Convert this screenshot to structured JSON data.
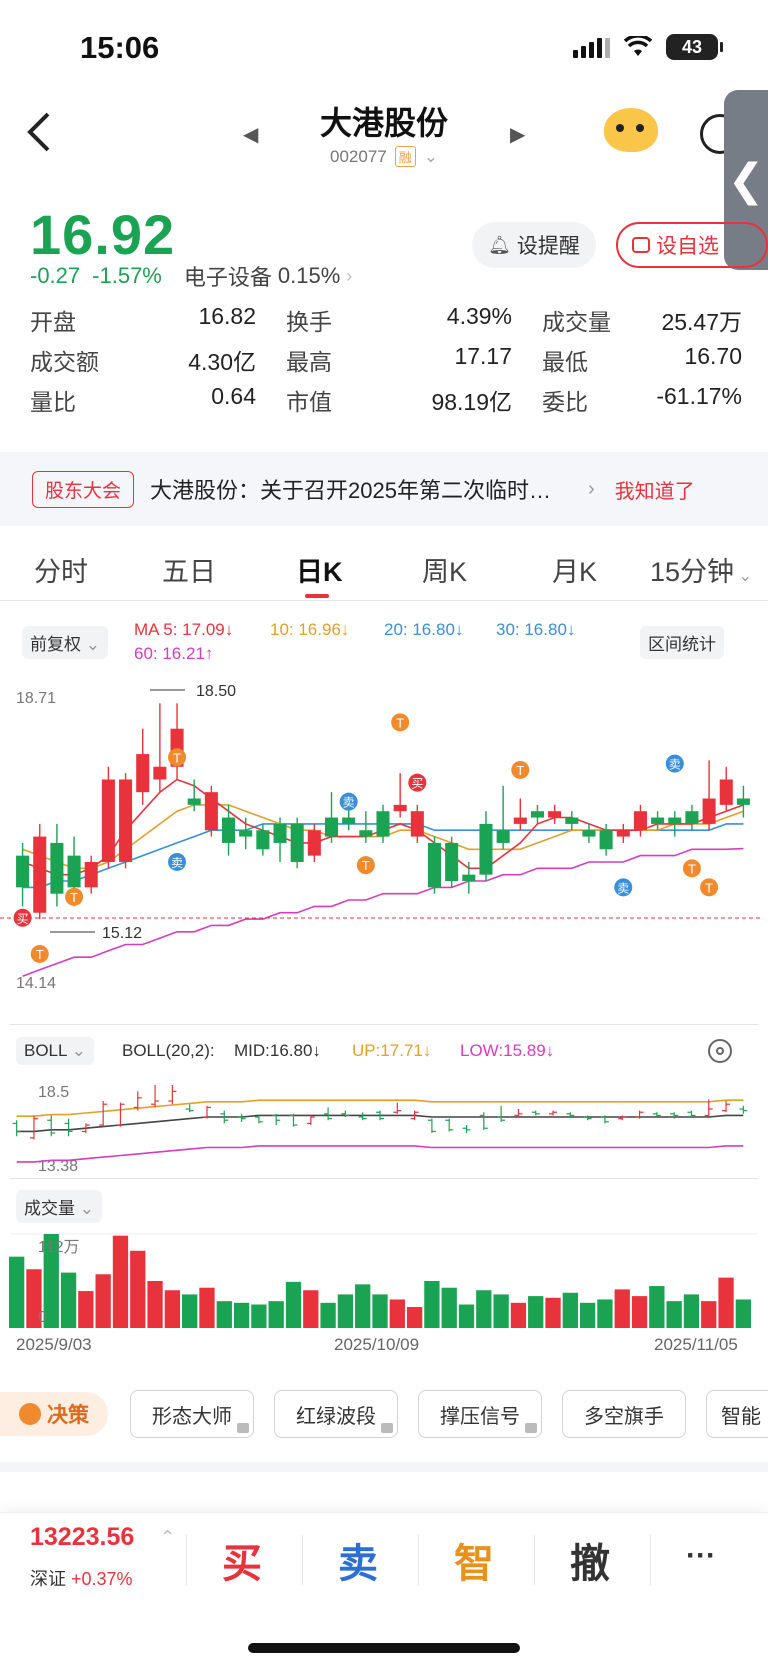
{
  "status_bar": {
    "time": "15:06",
    "battery": "43"
  },
  "header": {
    "stock_name": "大港股份",
    "stock_code": "002077",
    "margin_badge": "融",
    "side_tab_icon": "chevron-left-icon"
  },
  "quote": {
    "price": "16.92",
    "change": "-0.27",
    "change_pct": "-1.57%",
    "sector": "电子设备",
    "sector_pct": "0.15%",
    "alert_label": "设提醒",
    "watch_label": "设自选",
    "stats": [
      [
        {
          "label": "开盘",
          "value": "16.82",
          "color": "green"
        },
        {
          "label": "换手",
          "value": "4.39%",
          "color": "dark"
        },
        {
          "label": "成交量",
          "value": "25.47万",
          "color": "dark"
        }
      ],
      [
        {
          "label": "成交额",
          "value": "4.30亿",
          "color": "dark"
        },
        {
          "label": "最高",
          "value": "17.17",
          "color": "green"
        },
        {
          "label": "最低",
          "value": "16.70",
          "color": "green"
        }
      ],
      [
        {
          "label": "量比",
          "value": "0.64",
          "color": "dark"
        },
        {
          "label": "市值",
          "value": "98.19亿",
          "color": "dark"
        },
        {
          "label": "委比",
          "value": "-61.17%",
          "color": "green"
        }
      ]
    ]
  },
  "notice": {
    "tag": "股东大会",
    "text": "大港股份：关于召开2025年第二次临时…",
    "ack": "我知道了"
  },
  "tabs": [
    "分时",
    "五日",
    "日K",
    "周K",
    "月K",
    "15分钟"
  ],
  "active_tab": "日K",
  "ma": {
    "adjust": "前复权",
    "ma5": "MA 5: 17.09↓",
    "ma10": "10: 16.96↓",
    "ma20": "20: 16.80↓",
    "ma30": "30: 16.80↓",
    "ma60": "60: 16.21↑",
    "range_stats": "区间统计"
  },
  "kline": {
    "y_top_label": "18.71",
    "y_bottom_label": "14.14",
    "max_label": "18.50",
    "min_label": "15.12",
    "signal_buy": "买",
    "signal_sell": "卖",
    "signal_t": "T"
  },
  "boll": {
    "name": "BOLL",
    "params": "BOLL(20,2):",
    "mid": "MID:16.80↓",
    "up": "UP:17.71↓",
    "low": "LOW:15.89↓",
    "y_top": "18.5",
    "y_bottom": "13.38"
  },
  "volume": {
    "name": "成交量",
    "y_top": "112万",
    "y_bottom": "0"
  },
  "dates": [
    "2025/9/03",
    "2025/10/09",
    "2025/11/05"
  ],
  "tools": {
    "decision": "决策",
    "items": [
      "形态大师",
      "红绿波段",
      "撑压信号",
      "多空旗手",
      "智能"
    ]
  },
  "bottom": {
    "index_value": "13223.56",
    "index_name": "深证",
    "index_change": "+0.37%",
    "buy": "买",
    "sell": "卖",
    "smart": "智",
    "cancel": "撤",
    "more": "···"
  },
  "colors": {
    "up": "#e8323c",
    "down": "#1aa352",
    "ma5": "#e8323c",
    "ma10": "#e0a12a",
    "ma20": "#3a8fd9",
    "ma30": "#5bb8c9",
    "ma60": "#d63cc0"
  },
  "chart_data": [
    {
      "type": "candlestick",
      "title": "日K",
      "x_start": "2025/9/03",
      "x_end": "2025/11/05",
      "ylim": [
        14.14,
        18.71
      ],
      "candles": [
        [
          16.1,
          15.6,
          16.3,
          15.3
        ],
        [
          15.2,
          16.4,
          16.6,
          15.1
        ],
        [
          16.3,
          15.5,
          16.6,
          15.3
        ],
        [
          16.1,
          15.6,
          16.4,
          15.3
        ],
        [
          15.6,
          16.0,
          16.1,
          15.5
        ],
        [
          16.0,
          17.3,
          17.5,
          15.9
        ],
        [
          16.0,
          17.3,
          17.4,
          15.9
        ],
        [
          17.1,
          17.7,
          18.1,
          16.9
        ],
        [
          17.3,
          17.5,
          18.5,
          17.1
        ],
        [
          17.5,
          18.1,
          18.5,
          17.3
        ],
        [
          17.0,
          16.9,
          17.3,
          16.8
        ],
        [
          16.5,
          17.1,
          17.2,
          16.4
        ],
        [
          16.7,
          16.3,
          16.9,
          16.1
        ],
        [
          16.5,
          16.4,
          16.7,
          16.2
        ],
        [
          16.5,
          16.2,
          16.6,
          16.1
        ],
        [
          16.6,
          16.3,
          16.7,
          16.0
        ],
        [
          16.6,
          16.0,
          16.7,
          15.9
        ],
        [
          16.1,
          16.5,
          16.6,
          16.0
        ],
        [
          16.7,
          16.4,
          17.1,
          16.3
        ],
        [
          16.7,
          16.6,
          16.9,
          16.5
        ],
        [
          16.5,
          16.4,
          16.8,
          16.3
        ],
        [
          16.8,
          16.4,
          16.9,
          16.3
        ],
        [
          16.8,
          16.9,
          17.4,
          16.7
        ],
        [
          16.4,
          16.8,
          16.9,
          16.3
        ],
        [
          16.3,
          15.6,
          16.4,
          15.5
        ],
        [
          16.3,
          15.7,
          16.4,
          15.6
        ],
        [
          15.8,
          15.7,
          16.0,
          15.5
        ],
        [
          16.6,
          15.8,
          16.8,
          15.7
        ],
        [
          16.5,
          16.3,
          17.2,
          16.2
        ],
        [
          16.6,
          16.7,
          17.0,
          16.5
        ],
        [
          16.8,
          16.7,
          16.9,
          16.6
        ],
        [
          16.7,
          16.8,
          16.9,
          16.6
        ],
        [
          16.7,
          16.6,
          16.8,
          16.5
        ],
        [
          16.5,
          16.4,
          16.6,
          16.3
        ],
        [
          16.5,
          16.2,
          16.6,
          16.1
        ],
        [
          16.4,
          16.5,
          16.6,
          16.3
        ],
        [
          16.5,
          16.8,
          16.9,
          16.4
        ],
        [
          16.7,
          16.6,
          16.8,
          16.5
        ],
        [
          16.7,
          16.6,
          16.8,
          16.4
        ],
        [
          16.8,
          16.6,
          16.9,
          16.5
        ],
        [
          16.6,
          17.0,
          17.6,
          16.5
        ],
        [
          16.9,
          17.3,
          17.5,
          16.8
        ],
        [
          17.0,
          16.9,
          17.2,
          16.7
        ]
      ],
      "ma_lines": {
        "ma5": [
          16.0,
          15.9,
          15.8,
          15.8,
          15.9,
          16.1,
          16.5,
          16.8,
          17.1,
          17.3,
          17.2,
          17.0,
          16.8,
          16.6,
          16.5,
          16.4,
          16.3,
          16.3,
          16.4,
          16.4,
          16.4,
          16.5,
          16.6,
          16.5,
          16.3,
          16.1,
          15.9,
          15.9,
          16.1,
          16.3,
          16.6,
          16.7,
          16.7,
          16.6,
          16.5,
          16.5,
          16.5,
          16.6,
          16.6,
          16.6,
          16.7,
          16.8,
          16.9
        ],
        "ma10": [
          16.2,
          16.1,
          16.0,
          15.9,
          15.9,
          16.0,
          16.2,
          16.4,
          16.6,
          16.8,
          16.9,
          16.9,
          16.9,
          16.8,
          16.7,
          16.6,
          16.5,
          16.5,
          16.4,
          16.4,
          16.4,
          16.4,
          16.5,
          16.5,
          16.4,
          16.3,
          16.2,
          16.2,
          16.2,
          16.2,
          16.3,
          16.4,
          16.5,
          16.5,
          16.5,
          16.5,
          16.5,
          16.5,
          16.6,
          16.6,
          16.6,
          16.7,
          16.8
        ],
        "ma20": [
          15.6,
          15.6,
          15.7,
          15.7,
          15.8,
          15.9,
          16.0,
          16.1,
          16.2,
          16.3,
          16.4,
          16.5,
          16.5,
          16.5,
          16.6,
          16.6,
          16.6,
          16.6,
          16.6,
          16.6,
          16.6,
          16.6,
          16.6,
          16.6,
          16.5,
          16.5,
          16.5,
          16.5,
          16.5,
          16.5,
          16.5,
          16.5,
          16.5,
          16.5,
          16.5,
          16.5,
          16.5,
          16.5,
          16.5,
          16.5,
          16.5,
          16.6,
          16.6
        ],
        "ma60": [
          14.2,
          14.3,
          14.4,
          14.5,
          14.5,
          14.6,
          14.7,
          14.7,
          14.8,
          14.9,
          14.9,
          15.0,
          15.0,
          15.1,
          15.1,
          15.2,
          15.2,
          15.3,
          15.3,
          15.4,
          15.4,
          15.5,
          15.5,
          15.5,
          15.6,
          15.6,
          15.7,
          15.7,
          15.8,
          15.8,
          15.9,
          15.9,
          15.9,
          16.0,
          16.0,
          16.0,
          16.1,
          16.1,
          16.1,
          16.2,
          16.2,
          16.2,
          16.21
        ]
      }
    },
    {
      "type": "bar",
      "title": "成交量",
      "ylim": [
        0,
        112
      ],
      "unit": "万",
      "values": [
        85,
        70,
        112,
        66,
        44,
        64,
        110,
        92,
        56,
        45,
        40,
        48,
        32,
        30,
        28,
        32,
        55,
        45,
        30,
        40,
        52,
        40,
        34,
        25,
        56,
        48,
        28,
        45,
        40,
        30,
        38,
        36,
        42,
        30,
        34,
        46,
        38,
        50,
        32,
        40,
        32,
        60,
        34
      ]
    }
  ]
}
